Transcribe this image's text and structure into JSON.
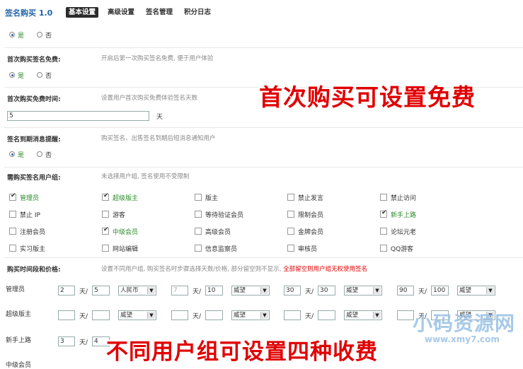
{
  "header": {
    "app_title": "签名购买 1.0",
    "tabs": [
      "基本设置",
      "高级设置",
      "签名管理",
      "积分日志"
    ]
  },
  "yes_label": "是",
  "no_label": "否",
  "settings": [
    {
      "label": "首次购买签名免费:",
      "desc": "开启后第一次购买签名免费, 便于用户体验"
    },
    {
      "label": "首次购买免费时间:",
      "desc": "设置用户首次购买免费体验签名天数",
      "value": "5",
      "unit": "天"
    },
    {
      "label": "签名到期消息提醒:",
      "desc": "购买签名、出售签名到期后短消息通知用户"
    },
    {
      "label": "需购买签名用户组:",
      "desc": "未选择用户组, 签名使用不受限制"
    }
  ],
  "groups": [
    {
      "name": "管理员",
      "checked": true,
      "hl": true
    },
    {
      "name": "超级版主",
      "checked": true,
      "hl": true
    },
    {
      "name": "版主",
      "checked": false,
      "hl": false
    },
    {
      "name": "禁止发言",
      "checked": false,
      "hl": false
    },
    {
      "name": "禁止访问",
      "checked": false,
      "hl": false
    },
    {
      "name": "禁止 IP",
      "checked": false,
      "hl": false
    },
    {
      "name": "游客",
      "checked": false,
      "hl": false
    },
    {
      "name": "等待验证会员",
      "checked": false,
      "hl": false
    },
    {
      "name": "限制会员",
      "checked": false,
      "hl": false
    },
    {
      "name": "新手上路",
      "checked": true,
      "hl": true
    },
    {
      "name": "注册会员",
      "checked": false,
      "hl": false
    },
    {
      "name": "中级会员",
      "checked": true,
      "hl": true
    },
    {
      "name": "高级会员",
      "checked": false,
      "hl": false
    },
    {
      "name": "金牌会员",
      "checked": false,
      "hl": false
    },
    {
      "name": "论坛元老",
      "checked": false,
      "hl": false
    },
    {
      "name": "实习版主",
      "checked": false,
      "hl": false
    },
    {
      "name": "网站编辑",
      "checked": false,
      "hl": false
    },
    {
      "name": "信息监察员",
      "checked": false,
      "hl": false
    },
    {
      "name": "审核员",
      "checked": false,
      "hl": false
    },
    {
      "name": "QQ游客",
      "checked": false,
      "hl": false
    }
  ],
  "pricing": {
    "label": "购买时间段和价格:",
    "desc": "设置不同用户组, 购买签名时步骤选择天数/价格, 部分留空则不显示, ",
    "desc_red": "全部留空则用户组无权使用签名",
    "days_unit": "天/",
    "rows": [
      {
        "group": "管理员",
        "slots": [
          {
            "days": "2",
            "price": "5",
            "currency": "人民币"
          },
          {
            "days": "7",
            "price": "10",
            "currency": "威望"
          },
          {
            "days": "30",
            "price": "30",
            "currency": "威望"
          },
          {
            "days": "90",
            "price": "100",
            "currency": "威望"
          }
        ]
      },
      {
        "group": "超级版主",
        "slots": [
          {
            "days": "",
            "price": "",
            "currency": "威望"
          },
          {
            "days": "",
            "price": "",
            "currency": "威望"
          },
          {
            "days": "",
            "price": "",
            "currency": "威望"
          },
          {
            "days": "",
            "price": "",
            "currency": "威望"
          }
        ]
      },
      {
        "group": "新手上路",
        "slots": [
          {
            "days": "3",
            "price": "4",
            "currency": ""
          }
        ]
      },
      {
        "group": "中级会员",
        "slots": []
      }
    ]
  },
  "overlays": {
    "top": "首次购买可设置免费",
    "bottom": "不同用户组可设置四种收费"
  },
  "watermark": {
    "text": "小码资源网",
    "url": "www.xmy7.com"
  }
}
